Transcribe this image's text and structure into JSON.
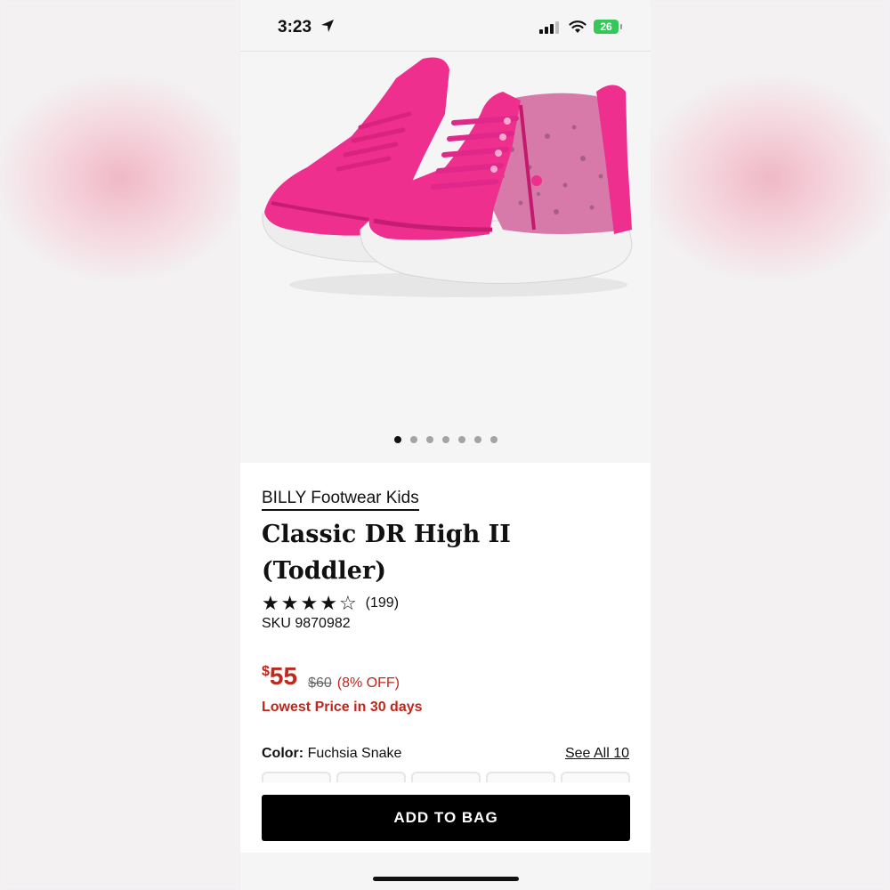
{
  "status_bar": {
    "time": "3:23",
    "battery": "26"
  },
  "product": {
    "brand": "BILLY Footwear Kids",
    "title": "Classic DR High II (Toddler)",
    "rating": 4,
    "rating_max": 5,
    "review_count": "(199)",
    "sku": "SKU 9870982"
  },
  "price": {
    "currency": "$",
    "current": "55",
    "original": "$60",
    "discount": "(8% OFF)",
    "lowest_note": "Lowest Price in 30 days"
  },
  "color": {
    "label": "Color:",
    "value": "Fuchsia Snake",
    "see_all": "See All 10"
  },
  "gallery": {
    "total_images": 7,
    "active_index": 0
  },
  "actions": {
    "add_to_bag": "ADD TO BAG"
  },
  "colors": {
    "accent_sale": "#c0271d",
    "shoe_pink": "#ee2f8e",
    "button_bg": "#000000"
  }
}
